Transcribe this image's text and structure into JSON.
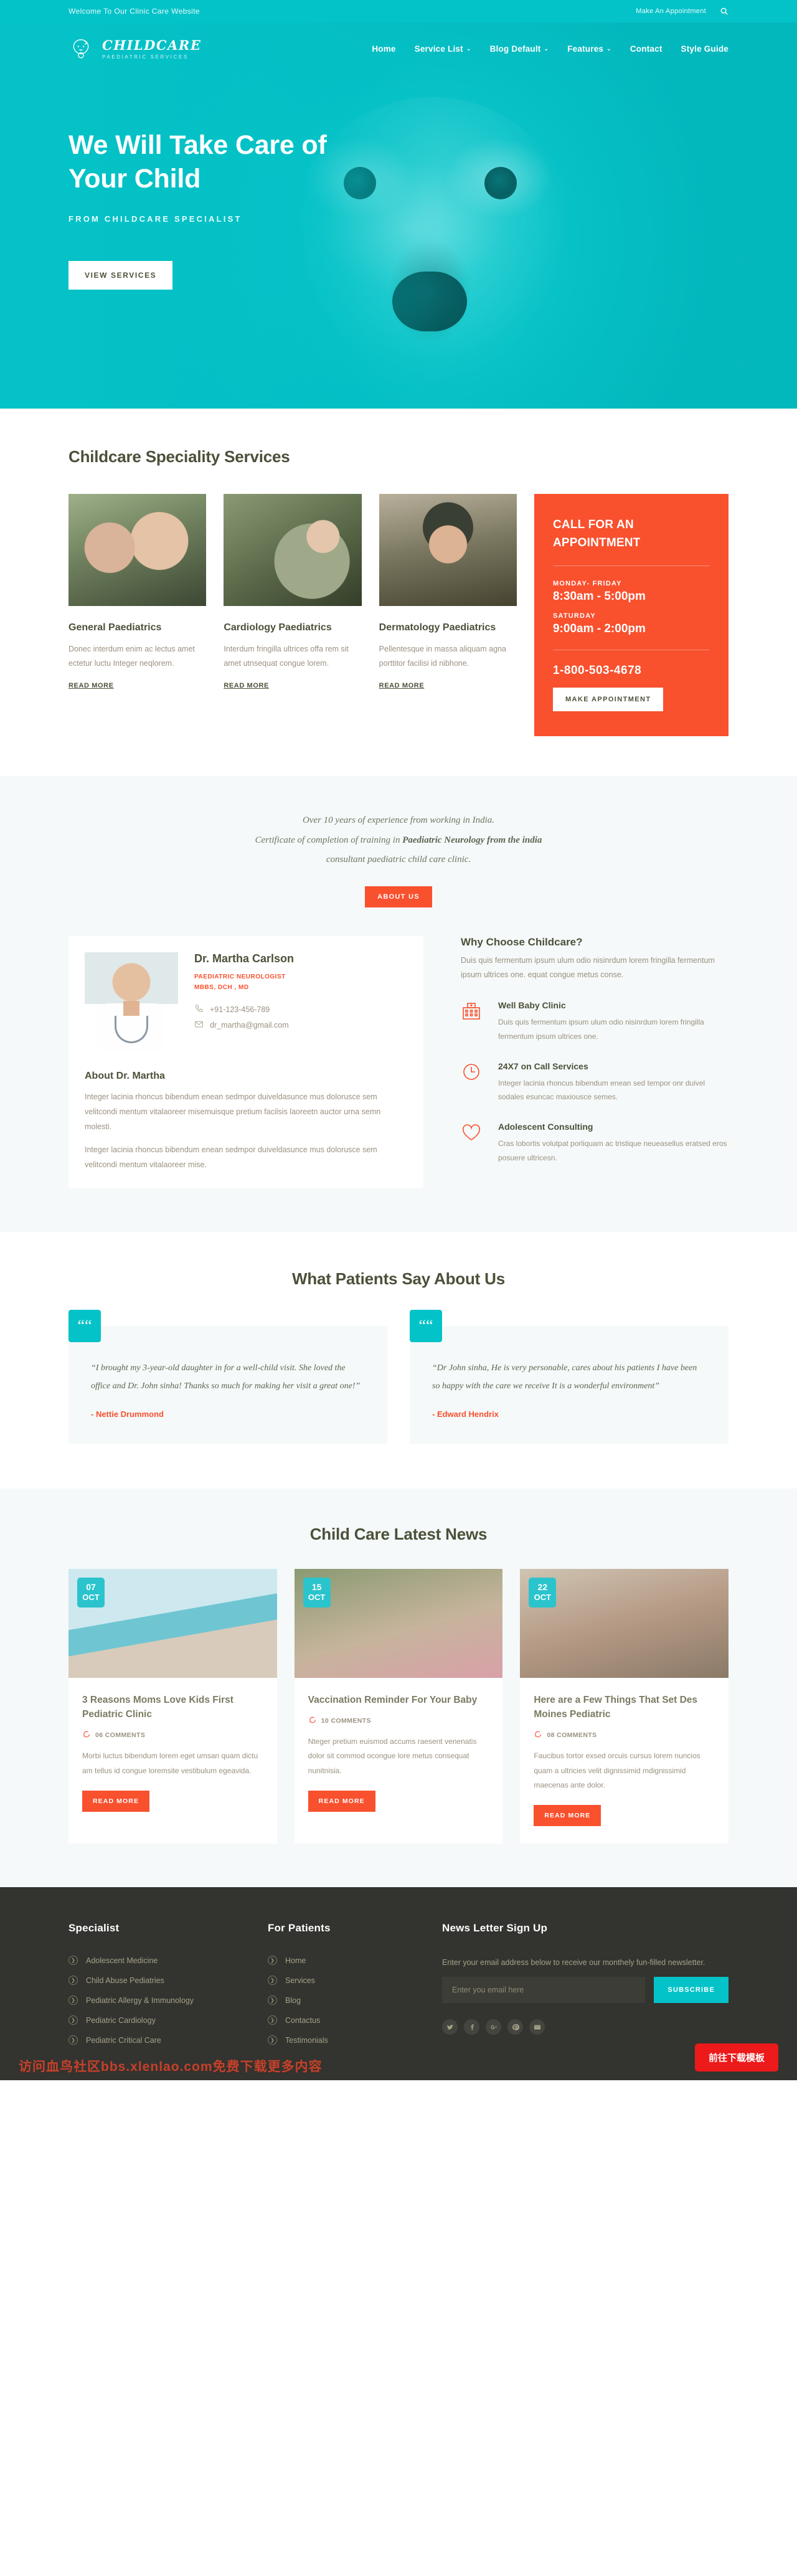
{
  "topbar": {
    "welcome": "Welcome To Our Clinic Care Website",
    "appointment_link": "Make An Appointment",
    "search_icon": "search-icon"
  },
  "brand": {
    "name": "CHILDCARE",
    "sub": "PAEDIATRIC SERVICES",
    "logo_icon": "baby-face-icon"
  },
  "nav": [
    {
      "label": "Home",
      "caret": ""
    },
    {
      "label": "Service List",
      "caret": "⌄"
    },
    {
      "label": "Blog Default",
      "caret": "⌄"
    },
    {
      "label": "Features",
      "caret": "⌄"
    },
    {
      "label": "Contact",
      "caret": ""
    },
    {
      "label": "Style Guide",
      "caret": ""
    }
  ],
  "hero": {
    "heading": "We Will Take Care of Your Child",
    "subheading": "FROM CHILDCARE SPECIALIST",
    "cta": "VIEW SERVICES"
  },
  "services": {
    "title": "Childcare Speciality Services",
    "read_more": "READ MORE",
    "items": [
      {
        "name": "General Paediatrics",
        "desc": "Donec interdum enim ac lectus amet ectetur luctu Integer neqlorem."
      },
      {
        "name": "Cardiology Paediatrics",
        "desc": "Interdum fringilla ultrices offa rem sit amet utnsequat congue lorem."
      },
      {
        "name": "Dermatology Paediatrics",
        "desc": "Pellentesque in massa aliquam agna porttitor facilisi id nibhone."
      }
    ],
    "appointment": {
      "title": "CALL FOR AN APPOINTMENT",
      "weekday_label": "MONDAY- FRIDAY",
      "weekday_time": "8:30am - 5:00pm",
      "saturday_label": "SATURDAY",
      "saturday_time": "9:00am - 2:00pm",
      "phone": "1-800-503-4678",
      "cta": "MAKE APPOINTMENT"
    }
  },
  "about": {
    "line1": "Over 10 years of experience from working in India.",
    "line2_pre": "Certificate of completion of training in ",
    "line2_bold": "Paediatric Neurology from the india",
    "line3": "consultant paediatric child care clinic.",
    "cta": "ABOUT US",
    "doctor": {
      "name": "Dr. Martha Carlson",
      "role": "PAEDIATRIC NEUROLOGIST",
      "degrees": "MBBS, DCH , MD",
      "phone": "+91-123-456-789",
      "email": "dr_martha@gmail.com",
      "phone_icon": "phone-icon",
      "email_icon": "envelope-icon",
      "about_heading": "About Dr. Martha",
      "about_p1": "Integer lacinia rhoncus bibendum enean sedmpor duiveldasunce mus dolorusce sem velitcondi mentum vitalaoreer misemuisque pretium facilsis laoreetn auctor urna semn molesti.",
      "about_p2": "Integer lacinia rhoncus bibendum enean sedmpor duiveldasunce mus dolorusce sem velitcondi mentum vitalaoreer mise."
    },
    "why": {
      "heading": "Why Choose Childcare?",
      "intro": "Duis quis fermentum ipsum ulum odio nisinrdum lorem fringilla fermentum ipsum ultrices one. equat congue metus conse.",
      "features": [
        {
          "icon": "hospital-icon",
          "title": "Well Baby Clinic",
          "desc": "Duis quis fermentum ipsum ulum odio nisinrdum lorem fringilla fermentum ipsum ultrices one."
        },
        {
          "icon": "clock-icon",
          "title": "24X7 on Call Services",
          "desc": "Integer lacinia rhoncus bibendum enean sed tempor onr duivel sodales esuncac maxiousce semes."
        },
        {
          "icon": "heart-icon",
          "title": "Adolescent Consulting",
          "desc": "Cras lobortis volutpat porliquam ac tristique neueasellus eratsed eros posuere ultricesn."
        }
      ]
    }
  },
  "testimonials": {
    "title": "What Patients Say About Us",
    "quote_icon": "quote-icon",
    "items": [
      {
        "text": "“I brought my 3-year-old daughter in for a well-child visit. She loved the office and Dr. John sinha! Thanks so much for making her visit a great one!”",
        "author": "- Nettie Drummond"
      },
      {
        "text": "“Dr John sinha, He is very personable, cares about his patients I have been so happy with the care we receive It is a wonderful environment”",
        "author": "- Edward Hendrix"
      }
    ]
  },
  "news": {
    "title": "Child Care Latest News",
    "read_more": "READ MORE",
    "comment_icon": "comment-icon",
    "items": [
      {
        "day": "07",
        "month": "OCT",
        "title": "3 Reasons Moms Love Kids First Pediatric Clinic",
        "comments": "06 COMMENTS",
        "desc": "Morbi luctus bibendum lorem eget umsan quam dictu am tellus id congue loremsite vestibulum egeavida."
      },
      {
        "day": "15",
        "month": "OCT",
        "title": "Vaccination Reminder For Your Baby",
        "comments": "10 COMMENTS",
        "desc": "Nteger pretium euismod accums raesent venenatis dolor sit commod ocongue lore metus consequat nunitnisia."
      },
      {
        "day": "22",
        "month": "OCT",
        "title": "Here are a Few Things That Set Des Moines Pediatric",
        "comments": "08 COMMENTS",
        "desc": "Faucibus tortor exsed orcuis cursus lorem nuncios quam a ultricies velit dignissimid mdignissimid maecenas ante dolor."
      }
    ]
  },
  "footer": {
    "specialist": {
      "heading": "Specialist",
      "items": [
        "Adolescent Medicine",
        "Child Abuse Pediatries",
        "Pediatric Allergy & Immunology",
        "Pediatric Cardiology",
        "Pediatric Critical Care"
      ]
    },
    "patients": {
      "heading": "For Patients",
      "items": [
        "Home",
        "Services",
        "Blog",
        "Contactus",
        "Testimonials"
      ]
    },
    "newsletter": {
      "heading": "News Letter Sign Up",
      "desc": "Enter your email address below to receive our monthely fun-filled newsletter.",
      "placeholder": "Enter you email here",
      "value": "",
      "button": "SUBSCRIBE"
    },
    "socials": [
      "twitter-icon",
      "facebook-icon",
      "google-plus-icon",
      "pinterest-icon",
      "envelope-icon"
    ],
    "watermark": "访问血鸟社区bbs.xlenlao.com免费下载更多内容",
    "download_button": "前往下载模板"
  }
}
